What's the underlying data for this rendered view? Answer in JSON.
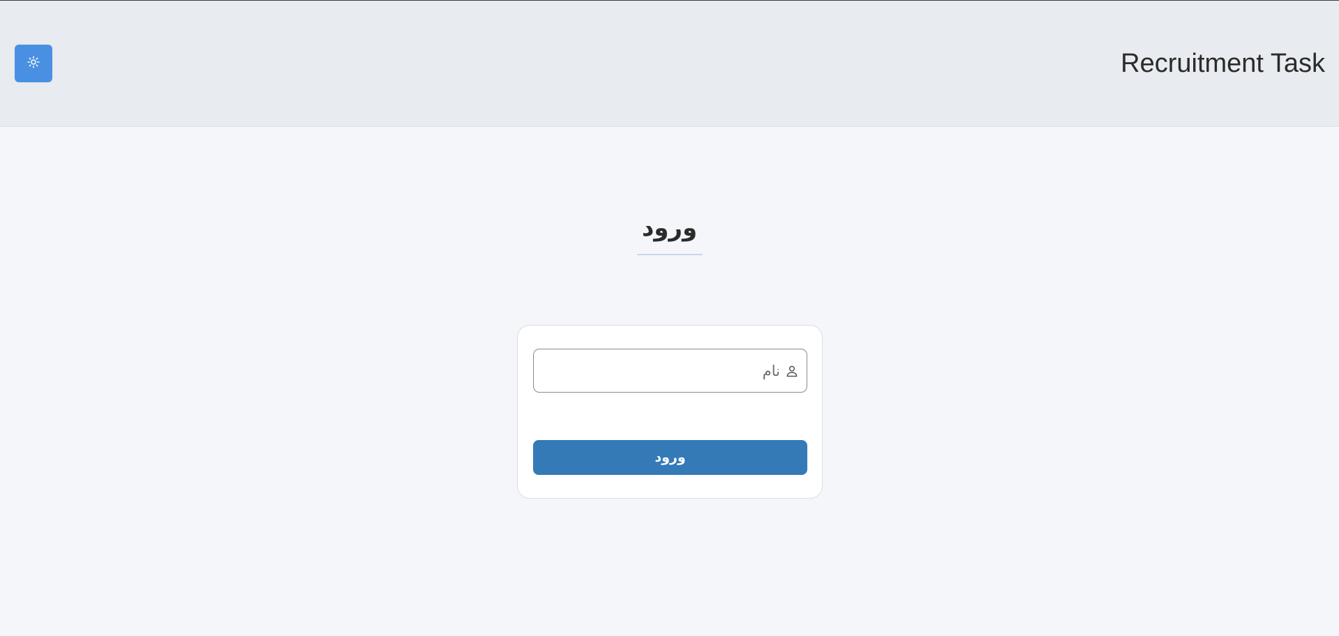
{
  "header": {
    "title": "Recruitment Task",
    "theme_toggle_icon": "sun-icon",
    "theme_toggle_color": "#4a90e2"
  },
  "login": {
    "heading": "ورود",
    "name_field": {
      "placeholder": "نام",
      "value": "",
      "icon": "user-icon"
    },
    "submit_label": "ورود",
    "submit_color": "#337ab7"
  }
}
